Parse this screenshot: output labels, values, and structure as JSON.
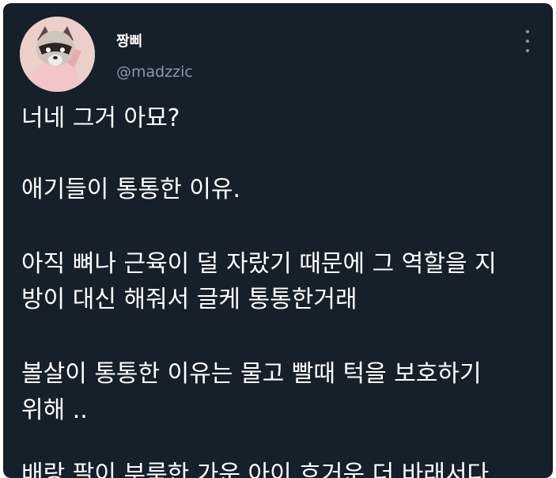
{
  "tweet": {
    "display_name": "짱삐",
    "handle": "@madzzic",
    "avatar_icon": "raccoon-avatar",
    "more_icon": "more-vertical-icon",
    "lines": [
      "너네 그거 아묘?",
      "애기들이 통통한 이유.",
      "아직 뼈나 근육이 덜 자랐기 때문에 그 역할을 지",
      "방이 대신 해줘서 글케 통통한거래",
      "볼살이 통통한 이유는 물고 빨때 턱을 보호하기",
      "위해 ..",
      "배랑 팔이 부룩한 가운 아이 흐거운 더 바래서다"
    ]
  },
  "colors": {
    "background": "#15202b",
    "text": "#ffffff",
    "secondary_text": "#8b98a5"
  }
}
